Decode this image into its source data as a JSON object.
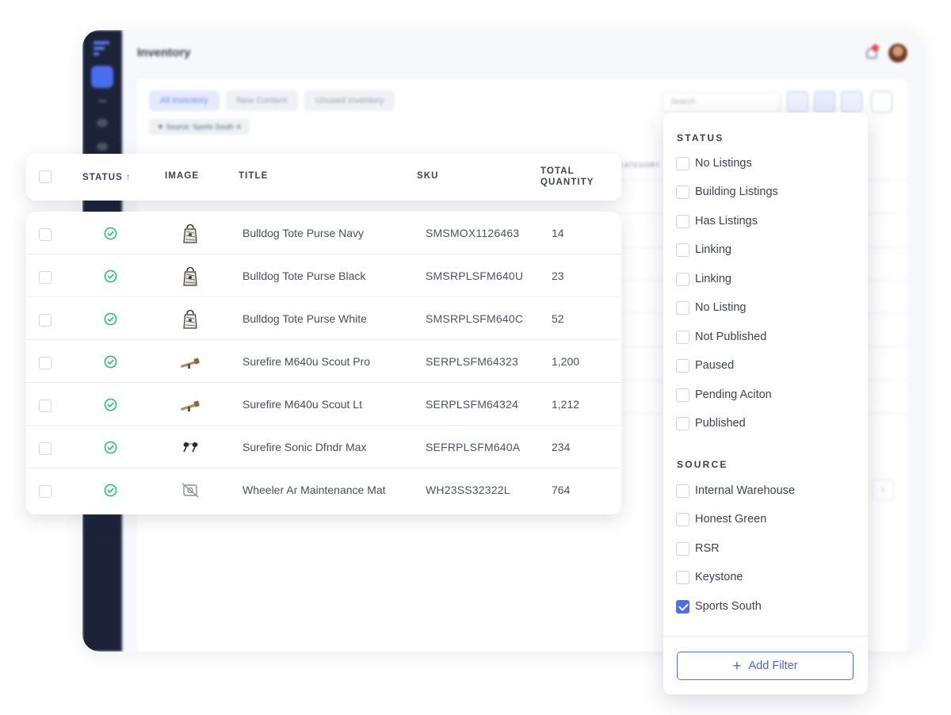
{
  "background_app": {
    "page_title": "Inventory",
    "tabs": [
      "All Inventory",
      "New Content",
      "Unused Inventory"
    ],
    "active_filter_chip": "▼ Source: Sports South ✕",
    "search_placeholder": "Search"
  },
  "table": {
    "columns": {
      "status": "STATUS",
      "image": "IMAGE",
      "title": "TITLE",
      "sku": "SKU",
      "total_quantity_line1": "TOTAL",
      "total_quantity_line2": "QUANTITY"
    },
    "sort_indicator": "↑",
    "rows": [
      {
        "title": "Bulldog Tote Purse Navy",
        "sku": "SMSMOX1126463",
        "qty": "14",
        "image": "tote-bag-icon"
      },
      {
        "title": "Bulldog Tote Purse Black",
        "sku": "SMSRPLSFM640U",
        "qty": "23",
        "image": "tote-bag-icon"
      },
      {
        "title": "Bulldog Tote Purse White",
        "sku": "SMSRPLSFM640C",
        "qty": "52",
        "image": "tote-bag-icon"
      },
      {
        "title": "Surefire M640u Scout Pro",
        "sku": "SERPLSFM64323",
        "qty": "1,200",
        "image": "flashlight-icon"
      },
      {
        "title": "Surefire M640u Scout Lt",
        "sku": "SERPLSFM64324",
        "qty": "1,212",
        "image": "flashlight-icon"
      },
      {
        "title": "Surefire Sonic Dfndr Max",
        "sku": "SEFRPLSFM640A",
        "qty": "234",
        "image": "earplugs-icon"
      },
      {
        "title": "Wheeler Ar Maintenance Mat",
        "sku": "WH23SS32322L",
        "qty": "764",
        "image": "no-image-icon"
      }
    ]
  },
  "filter_panel": {
    "status_title": "STATUS",
    "status_options": [
      {
        "label": "No Listings",
        "checked": false
      },
      {
        "label": "Building Listings",
        "checked": false
      },
      {
        "label": "Has Listings",
        "checked": false
      },
      {
        "label": "Linking",
        "checked": false
      },
      {
        "label": "Linking",
        "checked": false
      },
      {
        "label": "No Listing",
        "checked": false
      },
      {
        "label": "Not Published",
        "checked": false
      },
      {
        "label": "Paused",
        "checked": false
      },
      {
        "label": "Pending Aciton",
        "checked": false
      },
      {
        "label": "Published",
        "checked": false
      }
    ],
    "source_title": "SOURCE",
    "source_options": [
      {
        "label": "Internal Warehouse",
        "checked": false
      },
      {
        "label": "Honest Green",
        "checked": false
      },
      {
        "label": "RSR",
        "checked": false
      },
      {
        "label": "Keystone",
        "checked": false
      },
      {
        "label": "Sports South",
        "checked": true
      }
    ],
    "add_filter_label": "Add Filter",
    "add_filter_icon": "+"
  },
  "colors": {
    "accent": "#4f6fe6",
    "status_ok": "#2fbf71",
    "sidebar": "#1c2339"
  }
}
